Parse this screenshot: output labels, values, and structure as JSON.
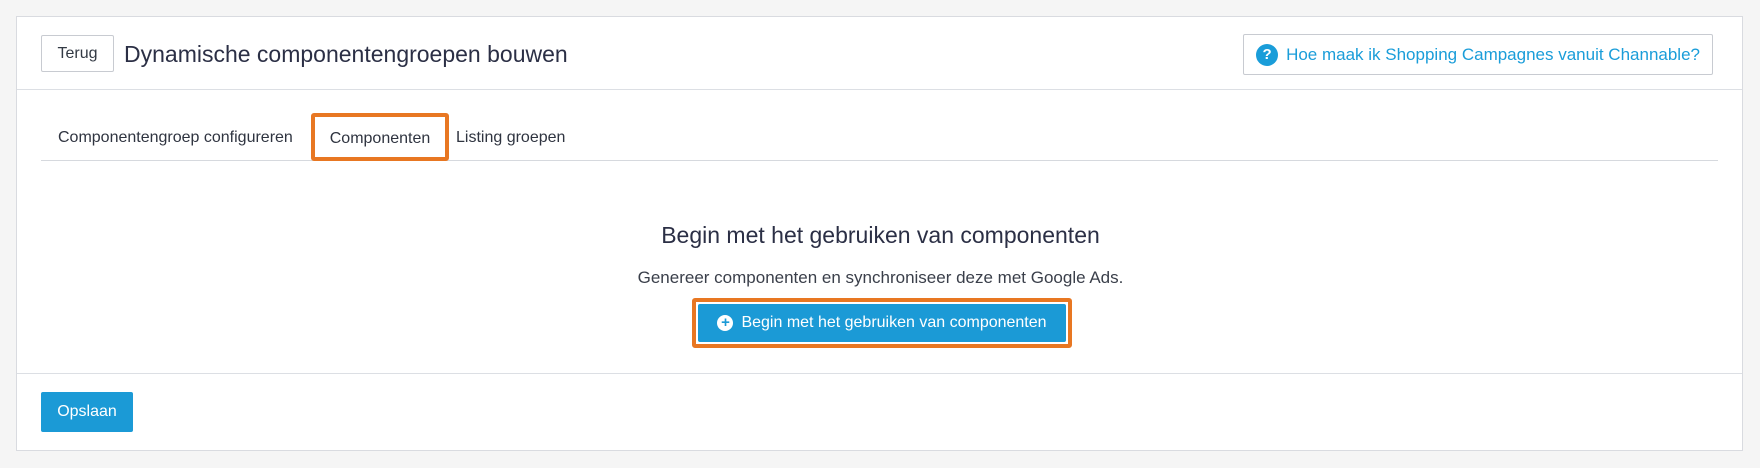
{
  "header": {
    "back_label": "Terug",
    "title": "Dynamische componentengroepen bouwen",
    "help_icon_glyph": "?",
    "help_link_label": "Hoe maak ik Shopping Campagnes vanuit Channable?"
  },
  "tabs": [
    {
      "label": "Componentengroep configureren",
      "active": false
    },
    {
      "label": "Componenten",
      "active": true,
      "highlighted": true
    },
    {
      "label": "Listing groepen",
      "active": false
    }
  ],
  "empty_state": {
    "title": "Begin met het gebruiken van componenten",
    "subtitle": "Genereer componenten en synchroniseer deze met Google Ads.",
    "button_icon": "plus-circle-icon",
    "button_icon_glyph": "+",
    "button_label": "Begin met het gebruiken van componenten"
  },
  "footer": {
    "save_label": "Opslaan"
  },
  "colors": {
    "accent": "#1b9ad6",
    "highlight": "#e87722",
    "link": "#1a9dd9"
  }
}
